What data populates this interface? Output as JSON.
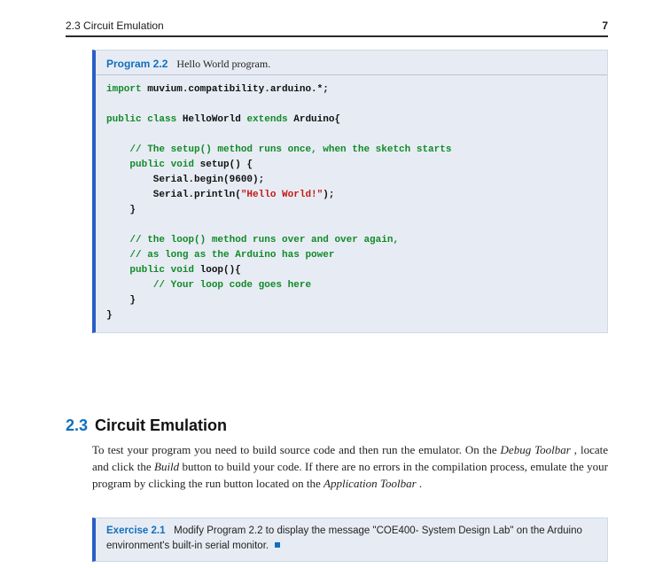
{
  "header": {
    "section_label": "2.3",
    "section_title": "Circuit Emulation",
    "page_number": "7"
  },
  "program": {
    "label": "Program 2.2",
    "title": "Hello World program.",
    "code_lines": [
      [
        [
          "kw",
          "import"
        ],
        [
          "",
          " muvium.compatibility.arduino.*;"
        ]
      ],
      [
        [
          "",
          ""
        ]
      ],
      [
        [
          "kw",
          "public class"
        ],
        [
          "",
          " "
        ],
        [
          "",
          "HelloWorld "
        ],
        [
          "kw",
          "extends"
        ],
        [
          "",
          " "
        ],
        [
          "",
          "Arduino{"
        ]
      ],
      [
        [
          "",
          ""
        ]
      ],
      [
        [
          "",
          "    "
        ],
        [
          "kw",
          "// The setup() method runs once, when the sketch starts"
        ]
      ],
      [
        [
          "",
          "    "
        ],
        [
          "kw",
          "public void"
        ],
        [
          "",
          " setup() {"
        ]
      ],
      [
        [
          "",
          "        Serial.begin(9600);"
        ]
      ],
      [
        [
          "",
          "        Serial.println("
        ],
        [
          "str",
          "\"Hello World!\""
        ],
        [
          "",
          ");"
        ]
      ],
      [
        [
          "",
          "    }"
        ]
      ],
      [
        [
          "",
          ""
        ]
      ],
      [
        [
          "",
          "    "
        ],
        [
          "kw",
          "// the loop() method runs over and over again,"
        ]
      ],
      [
        [
          "",
          "    "
        ],
        [
          "kw",
          "// as long as the Arduino has power"
        ]
      ],
      [
        [
          "",
          "    "
        ],
        [
          "kw",
          "public void"
        ],
        [
          "",
          " loop(){"
        ]
      ],
      [
        [
          "",
          "        "
        ],
        [
          "kw",
          "// Your loop code goes here"
        ]
      ],
      [
        [
          "",
          "    }"
        ]
      ],
      [
        [
          "",
          "}"
        ]
      ]
    ]
  },
  "section": {
    "number": "2.3",
    "title": "Circuit Emulation"
  },
  "body": {
    "pre": "To test your program you need to build source code and then run the emulator. On the ",
    "it1": "Debug Toolbar",
    "mid1": ", locate and click the ",
    "it2": "Build",
    "mid2": " button to build your code. If there are no errors in the compilation process, emulate the your program by clicking the run button located on the ",
    "it3": "Application Toolbar",
    "post": "."
  },
  "exercise": {
    "label": "Exercise 2.1",
    "text": "Modify Program 2.2 to display the message \"COE400- System Design Lab\" on the Arduino environment's built-in serial monitor."
  }
}
